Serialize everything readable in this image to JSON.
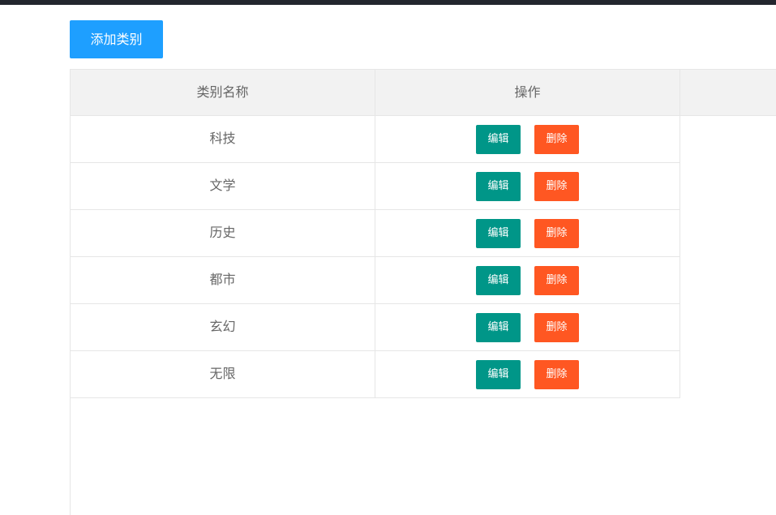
{
  "toolbar": {
    "add_label": "添加类别"
  },
  "table": {
    "columns": [
      "类别名称",
      "操作"
    ],
    "rows": [
      {
        "name": "科技",
        "edit_label": "编辑",
        "delete_label": "删除"
      },
      {
        "name": "文学",
        "edit_label": "编辑",
        "delete_label": "删除"
      },
      {
        "name": "历史",
        "edit_label": "编辑",
        "delete_label": "删除"
      },
      {
        "name": "都市",
        "edit_label": "编辑",
        "delete_label": "删除"
      },
      {
        "name": "玄幻",
        "edit_label": "编辑",
        "delete_label": "删除"
      },
      {
        "name": "无限",
        "edit_label": "编辑",
        "delete_label": "删除"
      }
    ]
  },
  "colors": {
    "primary": "#1e9fff",
    "edit": "#009688",
    "delete": "#ff5722",
    "header_bg": "#f2f2f2",
    "topbar": "#23262e"
  }
}
